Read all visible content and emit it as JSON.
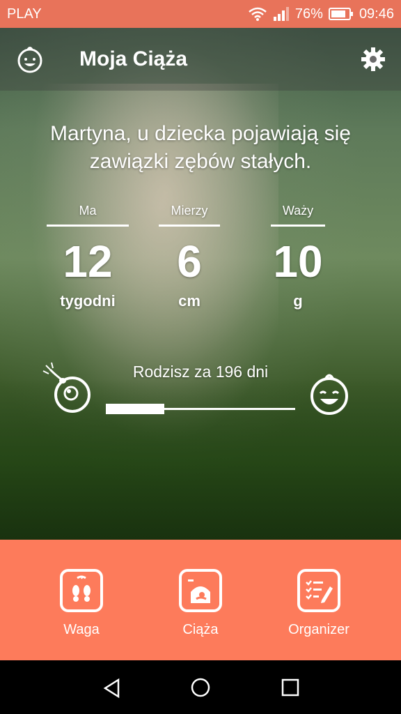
{
  "status_bar": {
    "carrier": "PLAY",
    "battery": "76%",
    "time": "09:46"
  },
  "app_bar": {
    "title": "Moja Ciąża"
  },
  "headline": "Martyna, u dziecka pojawiają się zawiązki zębów stałych.",
  "stats": [
    {
      "label": "Ma",
      "value": "12",
      "unit": "tygodni"
    },
    {
      "label": "Mierzy",
      "value": "6",
      "unit": "cm"
    },
    {
      "label": "Waży",
      "value": "10",
      "unit": "g"
    }
  ],
  "due": {
    "text": "Rodzisz za 196 dni",
    "progress": 0.31
  },
  "bottom_nav": [
    {
      "label": "Waga",
      "icon": "scale-icon"
    },
    {
      "label": "Ciąża",
      "icon": "ultrasound-icon"
    },
    {
      "label": "Organizer",
      "icon": "checklist-icon"
    }
  ],
  "colors": {
    "accent": "#fd7b5b",
    "status": "#e8735a"
  }
}
